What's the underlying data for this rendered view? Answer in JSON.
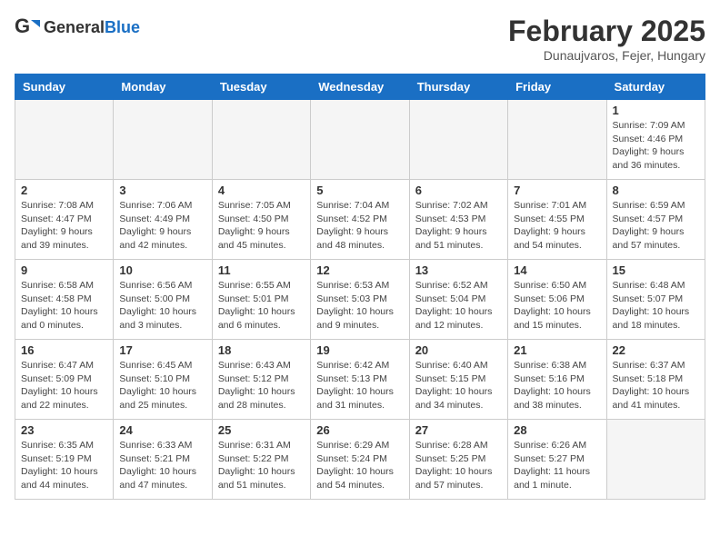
{
  "header": {
    "logo": {
      "general": "General",
      "blue": "Blue"
    },
    "title": "February 2025",
    "subtitle": "Dunaujvaros, Fejer, Hungary"
  },
  "calendar": {
    "weekdays": [
      "Sunday",
      "Monday",
      "Tuesday",
      "Wednesday",
      "Thursday",
      "Friday",
      "Saturday"
    ],
    "weeks": [
      [
        {
          "day": "",
          "info": ""
        },
        {
          "day": "",
          "info": ""
        },
        {
          "day": "",
          "info": ""
        },
        {
          "day": "",
          "info": ""
        },
        {
          "day": "",
          "info": ""
        },
        {
          "day": "",
          "info": ""
        },
        {
          "day": "1",
          "info": "Sunrise: 7:09 AM\nSunset: 4:46 PM\nDaylight: 9 hours and 36 minutes."
        }
      ],
      [
        {
          "day": "2",
          "info": "Sunrise: 7:08 AM\nSunset: 4:47 PM\nDaylight: 9 hours and 39 minutes."
        },
        {
          "day": "3",
          "info": "Sunrise: 7:06 AM\nSunset: 4:49 PM\nDaylight: 9 hours and 42 minutes."
        },
        {
          "day": "4",
          "info": "Sunrise: 7:05 AM\nSunset: 4:50 PM\nDaylight: 9 hours and 45 minutes."
        },
        {
          "day": "5",
          "info": "Sunrise: 7:04 AM\nSunset: 4:52 PM\nDaylight: 9 hours and 48 minutes."
        },
        {
          "day": "6",
          "info": "Sunrise: 7:02 AM\nSunset: 4:53 PM\nDaylight: 9 hours and 51 minutes."
        },
        {
          "day": "7",
          "info": "Sunrise: 7:01 AM\nSunset: 4:55 PM\nDaylight: 9 hours and 54 minutes."
        },
        {
          "day": "8",
          "info": "Sunrise: 6:59 AM\nSunset: 4:57 PM\nDaylight: 9 hours and 57 minutes."
        }
      ],
      [
        {
          "day": "9",
          "info": "Sunrise: 6:58 AM\nSunset: 4:58 PM\nDaylight: 10 hours and 0 minutes."
        },
        {
          "day": "10",
          "info": "Sunrise: 6:56 AM\nSunset: 5:00 PM\nDaylight: 10 hours and 3 minutes."
        },
        {
          "day": "11",
          "info": "Sunrise: 6:55 AM\nSunset: 5:01 PM\nDaylight: 10 hours and 6 minutes."
        },
        {
          "day": "12",
          "info": "Sunrise: 6:53 AM\nSunset: 5:03 PM\nDaylight: 10 hours and 9 minutes."
        },
        {
          "day": "13",
          "info": "Sunrise: 6:52 AM\nSunset: 5:04 PM\nDaylight: 10 hours and 12 minutes."
        },
        {
          "day": "14",
          "info": "Sunrise: 6:50 AM\nSunset: 5:06 PM\nDaylight: 10 hours and 15 minutes."
        },
        {
          "day": "15",
          "info": "Sunrise: 6:48 AM\nSunset: 5:07 PM\nDaylight: 10 hours and 18 minutes."
        }
      ],
      [
        {
          "day": "16",
          "info": "Sunrise: 6:47 AM\nSunset: 5:09 PM\nDaylight: 10 hours and 22 minutes."
        },
        {
          "day": "17",
          "info": "Sunrise: 6:45 AM\nSunset: 5:10 PM\nDaylight: 10 hours and 25 minutes."
        },
        {
          "day": "18",
          "info": "Sunrise: 6:43 AM\nSunset: 5:12 PM\nDaylight: 10 hours and 28 minutes."
        },
        {
          "day": "19",
          "info": "Sunrise: 6:42 AM\nSunset: 5:13 PM\nDaylight: 10 hours and 31 minutes."
        },
        {
          "day": "20",
          "info": "Sunrise: 6:40 AM\nSunset: 5:15 PM\nDaylight: 10 hours and 34 minutes."
        },
        {
          "day": "21",
          "info": "Sunrise: 6:38 AM\nSunset: 5:16 PM\nDaylight: 10 hours and 38 minutes."
        },
        {
          "day": "22",
          "info": "Sunrise: 6:37 AM\nSunset: 5:18 PM\nDaylight: 10 hours and 41 minutes."
        }
      ],
      [
        {
          "day": "23",
          "info": "Sunrise: 6:35 AM\nSunset: 5:19 PM\nDaylight: 10 hours and 44 minutes."
        },
        {
          "day": "24",
          "info": "Sunrise: 6:33 AM\nSunset: 5:21 PM\nDaylight: 10 hours and 47 minutes."
        },
        {
          "day": "25",
          "info": "Sunrise: 6:31 AM\nSunset: 5:22 PM\nDaylight: 10 hours and 51 minutes."
        },
        {
          "day": "26",
          "info": "Sunrise: 6:29 AM\nSunset: 5:24 PM\nDaylight: 10 hours and 54 minutes."
        },
        {
          "day": "27",
          "info": "Sunrise: 6:28 AM\nSunset: 5:25 PM\nDaylight: 10 hours and 57 minutes."
        },
        {
          "day": "28",
          "info": "Sunrise: 6:26 AM\nSunset: 5:27 PM\nDaylight: 11 hours and 1 minute."
        },
        {
          "day": "",
          "info": ""
        }
      ]
    ]
  }
}
